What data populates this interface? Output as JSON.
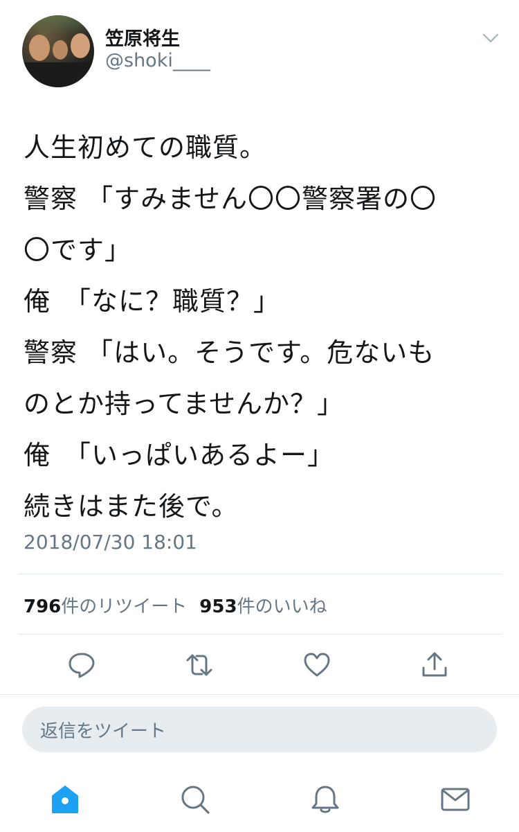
{
  "author": {
    "display_name": "笠原将生",
    "handle": "@shoki____"
  },
  "tweet": {
    "lines": [
      "人生初めての職質。",
      "警察 「すみません〇〇警察署の〇",
      "〇です」",
      "俺　「なに？職質？」",
      "警察 「はい。そうです。危ないも",
      "のとか持ってませんか？」",
      "俺　「いっぱいあるよー」",
      "続きはまた後で。"
    ],
    "timestamp": "2018/07/30 18:01"
  },
  "stats": {
    "retweet_count": "796",
    "retweet_label": "件のリツイート",
    "like_count": "953",
    "like_label": "件のいいね"
  },
  "reply": {
    "placeholder": "返信をツイート"
  },
  "icons": {
    "menu": "chevron-down-icon",
    "reply": "reply-icon",
    "retweet": "retweet-icon",
    "like": "heart-icon",
    "share": "share-icon",
    "home": "home-icon",
    "search": "search-icon",
    "notifications": "bell-icon",
    "messages": "mail-icon"
  },
  "colors": {
    "accent": "#1da1f2",
    "icon_gray": "#657786",
    "text": "#14171a",
    "reply_bg": "#e6ecf0"
  }
}
